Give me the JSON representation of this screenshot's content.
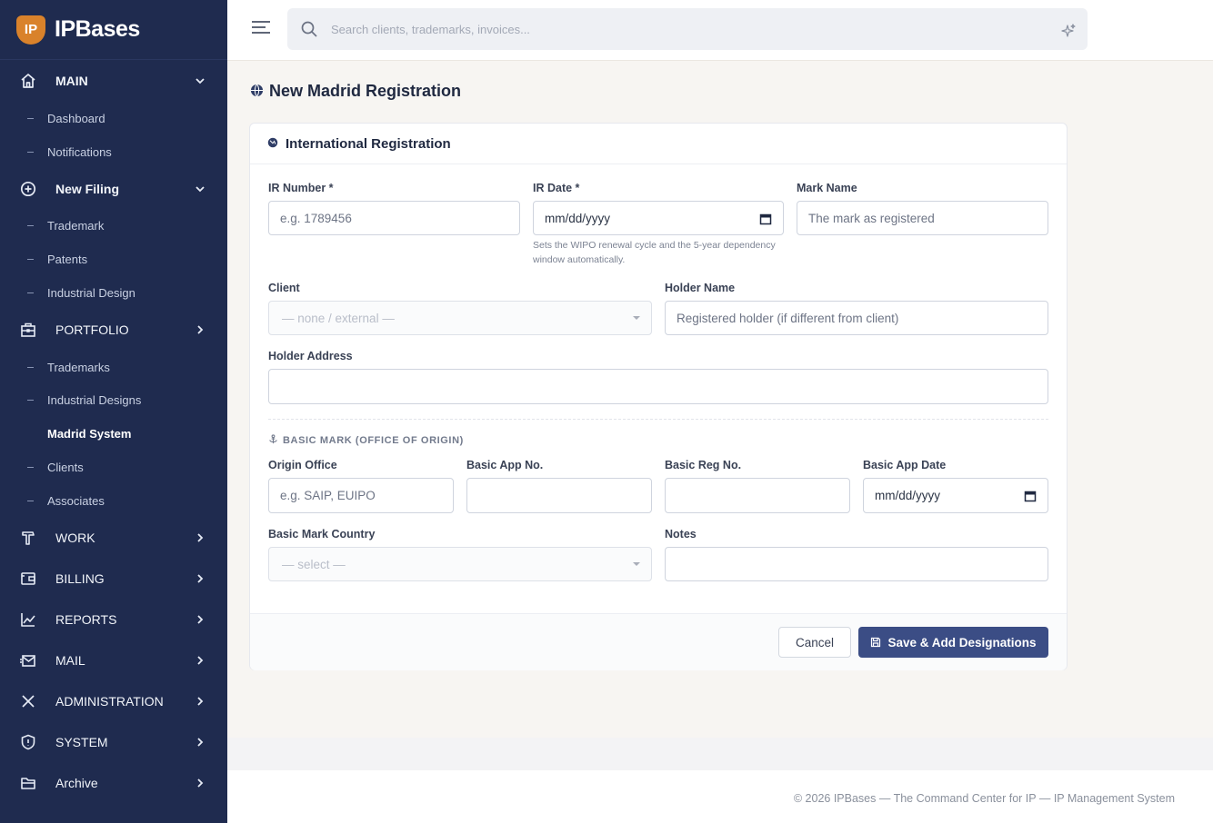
{
  "brand": {
    "name": "IPBases",
    "logo_text": "IP"
  },
  "sidebar": {
    "main_label": "MAIN",
    "main_items": [
      "Dashboard",
      "Notifications"
    ],
    "new_filing_label": "New Filing",
    "new_filing_items": [
      "Trademark",
      "Patents",
      "Industrial Design"
    ],
    "portfolio_label": "PORTFOLIO",
    "portfolio_items": [
      "Trademarks",
      "Industrial Designs",
      "Madrid System",
      "Clients",
      "Associates"
    ],
    "active_item": "Madrid System",
    "sections": [
      "WORK",
      "BILLING",
      "REPORTS",
      "MAIL",
      "ADMINISTRATION",
      "SYSTEM",
      "Archive"
    ]
  },
  "topbar": {
    "search_placeholder": "Search clients, trademarks, invoices..."
  },
  "page": {
    "title": "New Madrid Registration"
  },
  "card": {
    "title": "International Registration",
    "ir_number": {
      "label": "IR Number *",
      "placeholder": "e.g. 1789456"
    },
    "ir_date": {
      "label": "IR Date *",
      "value": "mm/dd/yyyy",
      "hint": "Sets the WIPO renewal cycle and the 5-year dependency window automatically."
    },
    "mark_name": {
      "label": "Mark Name",
      "placeholder": "The mark as registered"
    },
    "client": {
      "label": "Client",
      "value": "— none / external —"
    },
    "holder_name": {
      "label": "Holder Name",
      "placeholder": "Registered holder (if different from client)"
    },
    "holder_address": {
      "label": "Holder Address",
      "placeholder": ""
    },
    "basic_section": "BASIC MARK (OFFICE OF ORIGIN)",
    "origin_office": {
      "label": "Origin Office",
      "placeholder": "e.g. SAIP, EUIPO"
    },
    "basic_app_no": {
      "label": "Basic App No.",
      "placeholder": ""
    },
    "basic_reg_no": {
      "label": "Basic Reg No.",
      "placeholder": ""
    },
    "basic_app_date": {
      "label": "Basic App Date",
      "value": "mm/dd/yyyy"
    },
    "basic_mark_country": {
      "label": "Basic Mark Country",
      "value": "— select —"
    },
    "notes": {
      "label": "Notes",
      "placeholder": ""
    },
    "cancel_label": "Cancel",
    "save_label": "Save & Add Designations"
  },
  "footer": {
    "text": "© 2026 IPBases — The Command Center for IP — IP Management System"
  },
  "colors": {
    "sidebar_bg": "#1f2b4f",
    "primary": "#3b4d85",
    "logo": "#d9822b"
  }
}
